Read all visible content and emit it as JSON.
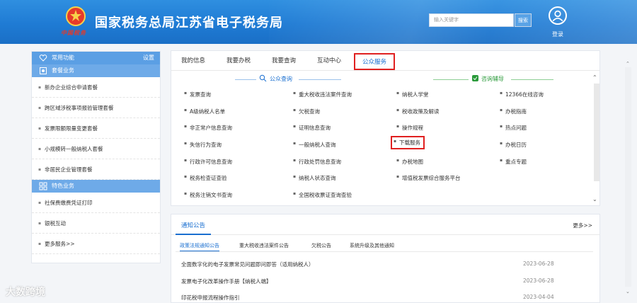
{
  "header": {
    "site_title": "国家税务总局江苏省电子税务局",
    "emblem_text": "中国税务",
    "search_placeholder": "输入关键字",
    "search_button": "搜索",
    "login": "登录"
  },
  "sidebar": {
    "common_label": "常用功能",
    "settings_label": "设置",
    "package_label": "套餐业务",
    "package_items": [
      "新办企业综合申请套餐",
      "跨区域涉税事项报验管理套餐",
      "发票限额限量变更套餐",
      "小规模转一般纳税人套餐",
      "非居民企业管理套餐"
    ],
    "special_label": "特色业务",
    "special_items": [
      "社保费缴费凭证打印",
      "银税互动",
      "更多服务>>"
    ]
  },
  "main": {
    "tabs": [
      "我的信息",
      "我要办税",
      "我要查询",
      "互动中心",
      "公众服务"
    ],
    "section_public_query": "公众查询",
    "section_consult": "咨询辅导",
    "links_col1": [
      "发票查询",
      "A级纳税人名单",
      "非正常户信息查询",
      "失信行为查询",
      "行政许可信息查询",
      "税务检查证查验",
      "税务注销文书查询"
    ],
    "links_col2": [
      "重大税收违法案件查询",
      "欠税查询",
      "证明信息查询",
      "一般纳税人查询",
      "行政处罚信息查询",
      "纳税人状态查询",
      "全国税收票证查询查验"
    ],
    "links_col3": [
      "纳税人学堂",
      "税收政策及解读",
      "操作规程",
      "下载服务",
      "办税地图",
      "增值税发票综合服务平台"
    ],
    "links_col4": [
      "12366在线咨询",
      "办税指南",
      "热点问题",
      "办税日历",
      "重点专题"
    ]
  },
  "notice": {
    "title": "通知公告",
    "more": "更多>>",
    "subtabs": [
      "政策法规通知公告",
      "重大税收违法案件公告",
      "欠税公告",
      "系统升级及其他通知"
    ],
    "rows": [
      {
        "title": "全面数字化的电子发票常见问题即问即答（适用纳税人）",
        "date": "2023-06-28"
      },
      {
        "title": "发票电子化改革操作手册【纳税人端】",
        "date": "2023-06-28"
      },
      {
        "title": "印花税申报流程操作指引",
        "date": "2023-04-04"
      }
    ]
  },
  "watermark": "大数跨境",
  "colors": {
    "brand_blue": "#1a6fd0",
    "highlight_red": "#e02020",
    "sidebar_head": "#5b9fe4",
    "consult_green": "#2a9a3a"
  }
}
